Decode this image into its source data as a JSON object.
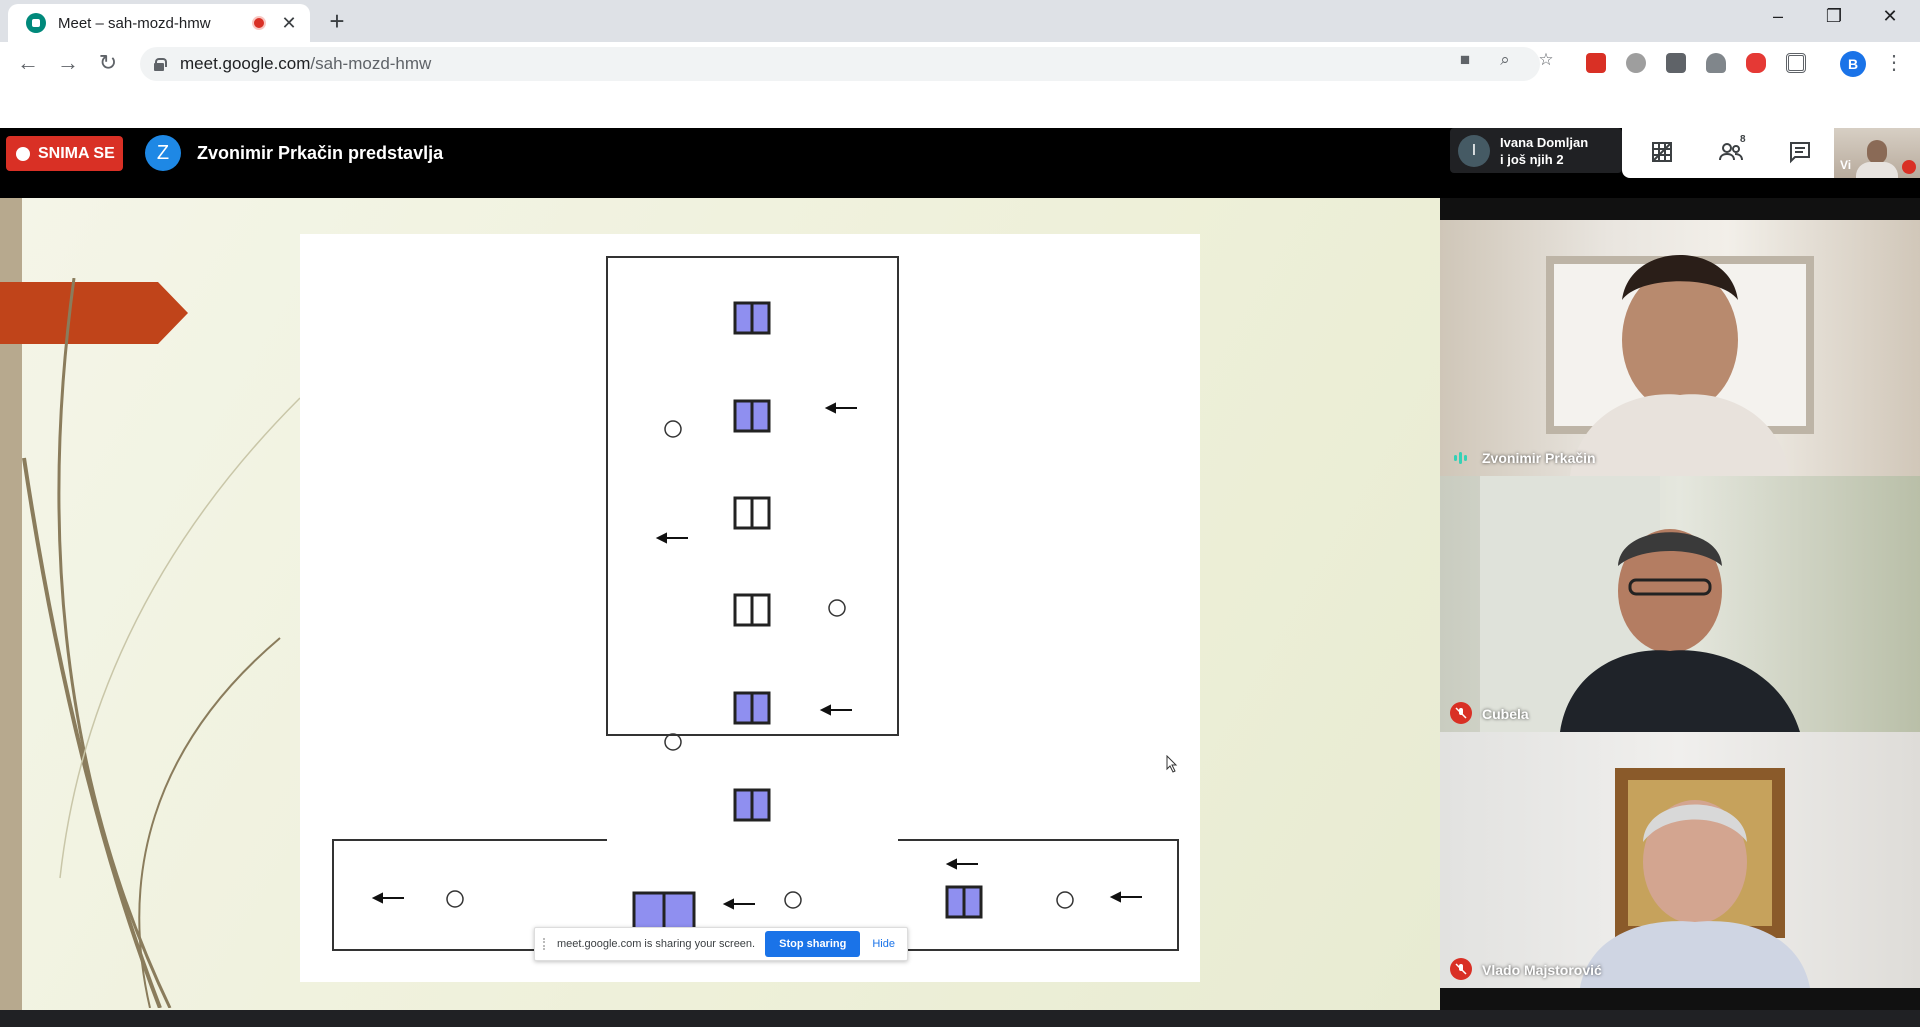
{
  "browser": {
    "tab_title": "Meet – sah-mozd-hmw",
    "url_host": "meet.google.com",
    "url_path": "/sah-mozd-hmw",
    "profile_initial": "B"
  },
  "meet": {
    "recording_label": "SNIMA SE",
    "presenter_initial": "Z",
    "presenter_title": "Zvonimir Prkačin predstavlja",
    "others_initial": "I",
    "others_line1": "Ivana Domljan",
    "others_line2": "i još njih 2",
    "participant_count": "8",
    "self_label": "Vi"
  },
  "share_bar": {
    "message": "meet.google.com is sharing your screen.",
    "stop_label": "Stop sharing",
    "hide_label": "Hide"
  },
  "tiles": [
    {
      "name": "Zvonimir Prkačin",
      "muted": false
    },
    {
      "name": "Cubela",
      "muted": true
    },
    {
      "name": "Vlado Majstorović",
      "muted": true
    }
  ],
  "colors": {
    "recording_red": "#d93025",
    "meet_blue": "#1a73e8",
    "presenter_blue": "#1e88e5",
    "slide_bg": "#eef0d9",
    "slide_accent": "#c0441a",
    "window_fill": "#8f8ff0"
  }
}
